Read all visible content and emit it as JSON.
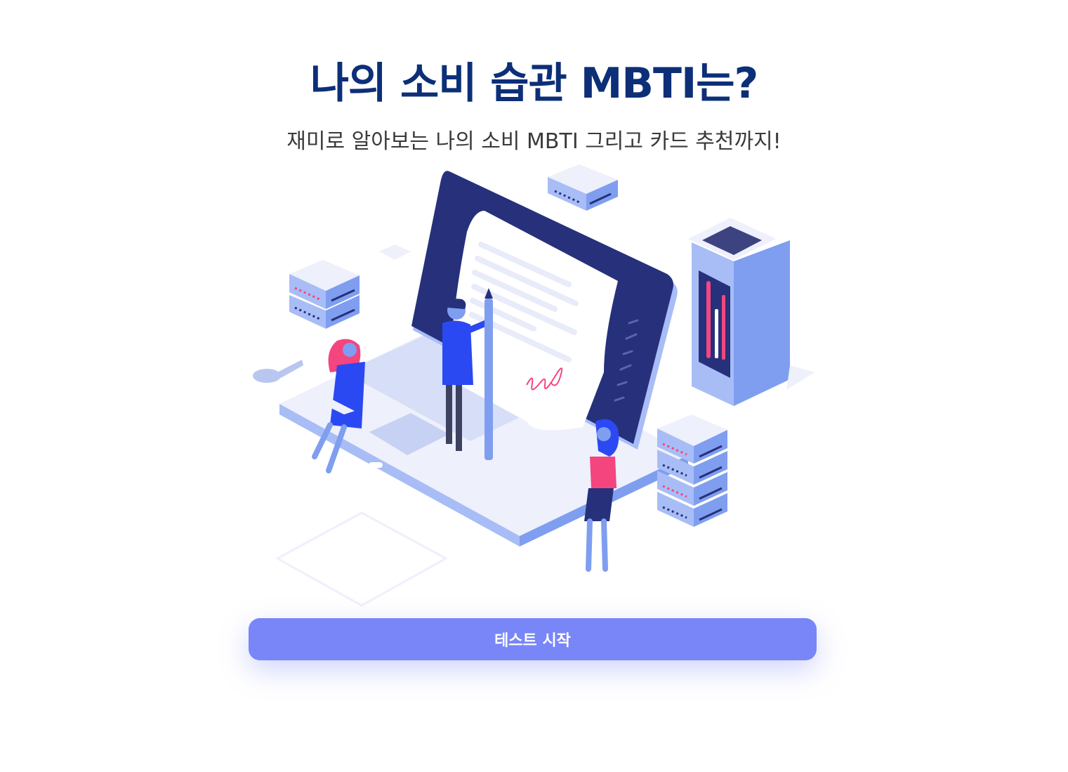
{
  "header": {
    "title": "나의 소비 습관 MBTI는?",
    "subtitle": "재미로 알아보는 나의 소비 MBTI 그리고 카드 추천까지!"
  },
  "hero": {
    "icon": "laptop-signature-illustration",
    "signature_text": "Ms"
  },
  "actions": {
    "start_label": "테스트 시작"
  },
  "colors": {
    "title": "#0c2f78",
    "accent": "#7886f8",
    "navy": "#27307a",
    "blue": "#2b49f2",
    "pink": "#f4457f",
    "light": "#eef0fc"
  }
}
